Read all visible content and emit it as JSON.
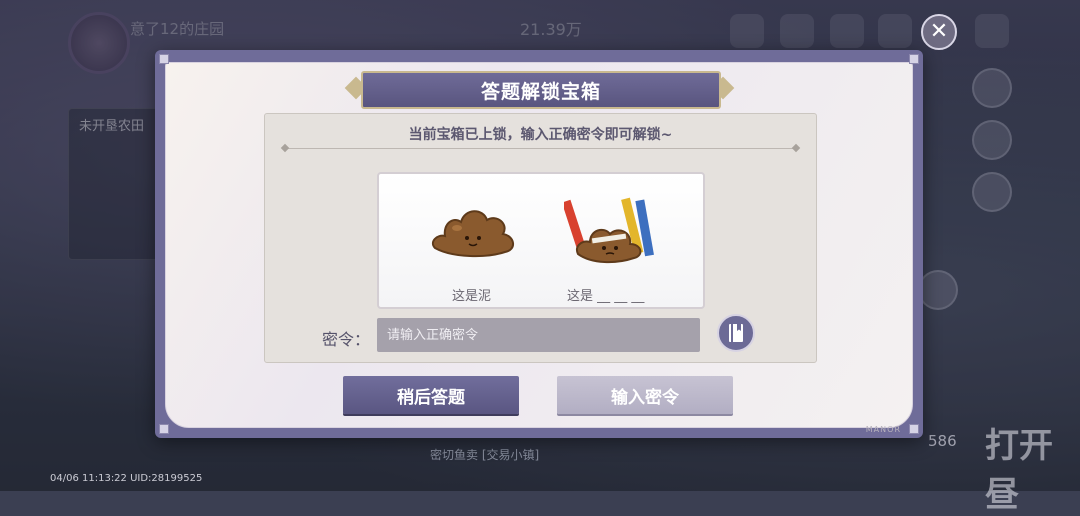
{
  "hud": {
    "player_name": "意了12的庄园",
    "coins": "21.39万",
    "quest_label": "未开垦农田",
    "status_bar": "04/06 11:13:22 UID:28199525",
    "chat_text": "密切鱼卖  [交易小镇]",
    "count": "586",
    "big_label": "打开昼"
  },
  "dialog": {
    "title": "答题解锁宝箱",
    "hint": "当前宝箱已上锁，输入正确密令即可解锁~",
    "captions": [
      "这是泥",
      "这是 __ __ __"
    ],
    "password_label": "密令：",
    "password_placeholder": "请输入正确密令",
    "password_value": "",
    "later_button": "稍后答题",
    "enter_button": "输入密令",
    "watermark": "MANOR"
  },
  "icons": {
    "close": "close-icon",
    "book": "book-icon",
    "mud": "mud-blob-icon",
    "pencils": "mud-pencils-icon"
  },
  "colors": {
    "dialog_frame": "#6f6c99",
    "primary_button": "#5a5682",
    "secondary_button": "#b2aec3",
    "panel": "#e5e1dd"
  }
}
